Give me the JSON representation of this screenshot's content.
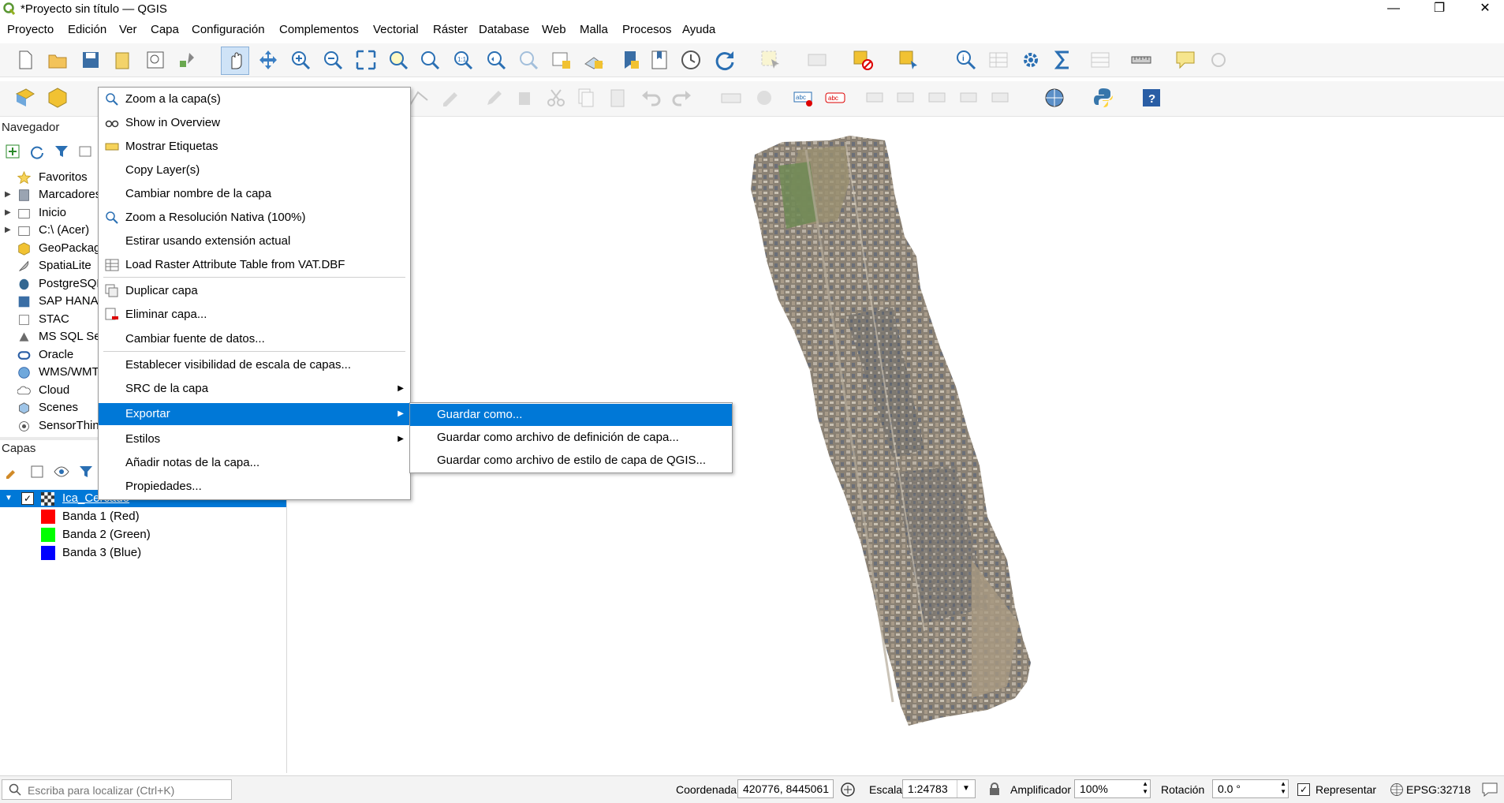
{
  "window": {
    "title": "*Proyecto sin título — QGIS",
    "minimize": "—",
    "maximize": "❐",
    "close": "✕"
  },
  "menu": [
    "Proyecto",
    "Edición",
    "Ver",
    "Capa",
    "Configuración",
    "Complementos",
    "Vectorial",
    "Ráster",
    "Database",
    "Web",
    "Malla",
    "Procesos",
    "Ayuda"
  ],
  "browser": {
    "title": "Navegador",
    "items": [
      "Favoritos",
      "Marcadores",
      "Inicio",
      "C:\\ (Acer)",
      "GeoPackage",
      "SpatiaLite",
      "PostgreSQL",
      "SAP HANA",
      "STAC",
      "MS SQL Server",
      "Oracle",
      "WMS/WMTS",
      "Cloud",
      "Scenes",
      "SensorThings"
    ]
  },
  "layers": {
    "title": "Capas",
    "layer_name": "Ica_Cercado",
    "bands": [
      {
        "label": "Banda 1 (Red)",
        "color": "#ff0000"
      },
      {
        "label": "Banda 2 (Green)",
        "color": "#00ff00"
      },
      {
        "label": "Banda 3 (Blue)",
        "color": "#0000ff"
      }
    ]
  },
  "context_menu": {
    "items": [
      {
        "label": "Zoom a la capa(s)"
      },
      {
        "label": "Show in Overview"
      },
      {
        "label": "Mostrar Etiquetas"
      },
      {
        "label": "Copy Layer(s)"
      },
      {
        "label": "Cambiar nombre de la capa"
      },
      {
        "label": "Zoom a Resolución Nativa (100%)"
      },
      {
        "label": "Estirar usando extensión actual"
      },
      {
        "label": "Load Raster Attribute Table from VAT.DBF"
      },
      {
        "label": "Duplicar capa"
      },
      {
        "label": "Eliminar capa..."
      },
      {
        "label": "Cambiar fuente de datos..."
      },
      {
        "label": "Establecer visibilidad de escala de capas..."
      },
      {
        "label": "SRC de la capa"
      },
      {
        "label": "Exportar"
      },
      {
        "label": "Estilos"
      },
      {
        "label": "Añadir notas de la capa..."
      },
      {
        "label": "Propiedades..."
      }
    ],
    "arrow": "▶"
  },
  "export_submenu": [
    "Guardar como...",
    "Guardar como archivo de definición de capa...",
    "Guardar como archivo de estilo de capa de QGIS..."
  ],
  "status": {
    "locator_placeholder": "Escriba para localizar (Ctrl+K)",
    "coord_label": "Coordenada",
    "coord_value": "420776, 8445061",
    "scale_label": "Escala",
    "scale_value": "1:24783",
    "magnifier_label": "Amplificador",
    "magnifier_value": "100%",
    "rotation_label": "Rotación",
    "rotation_value": "0.0 °",
    "render_label": "Representar",
    "render_checked": true,
    "crs": "EPSG:32718"
  }
}
